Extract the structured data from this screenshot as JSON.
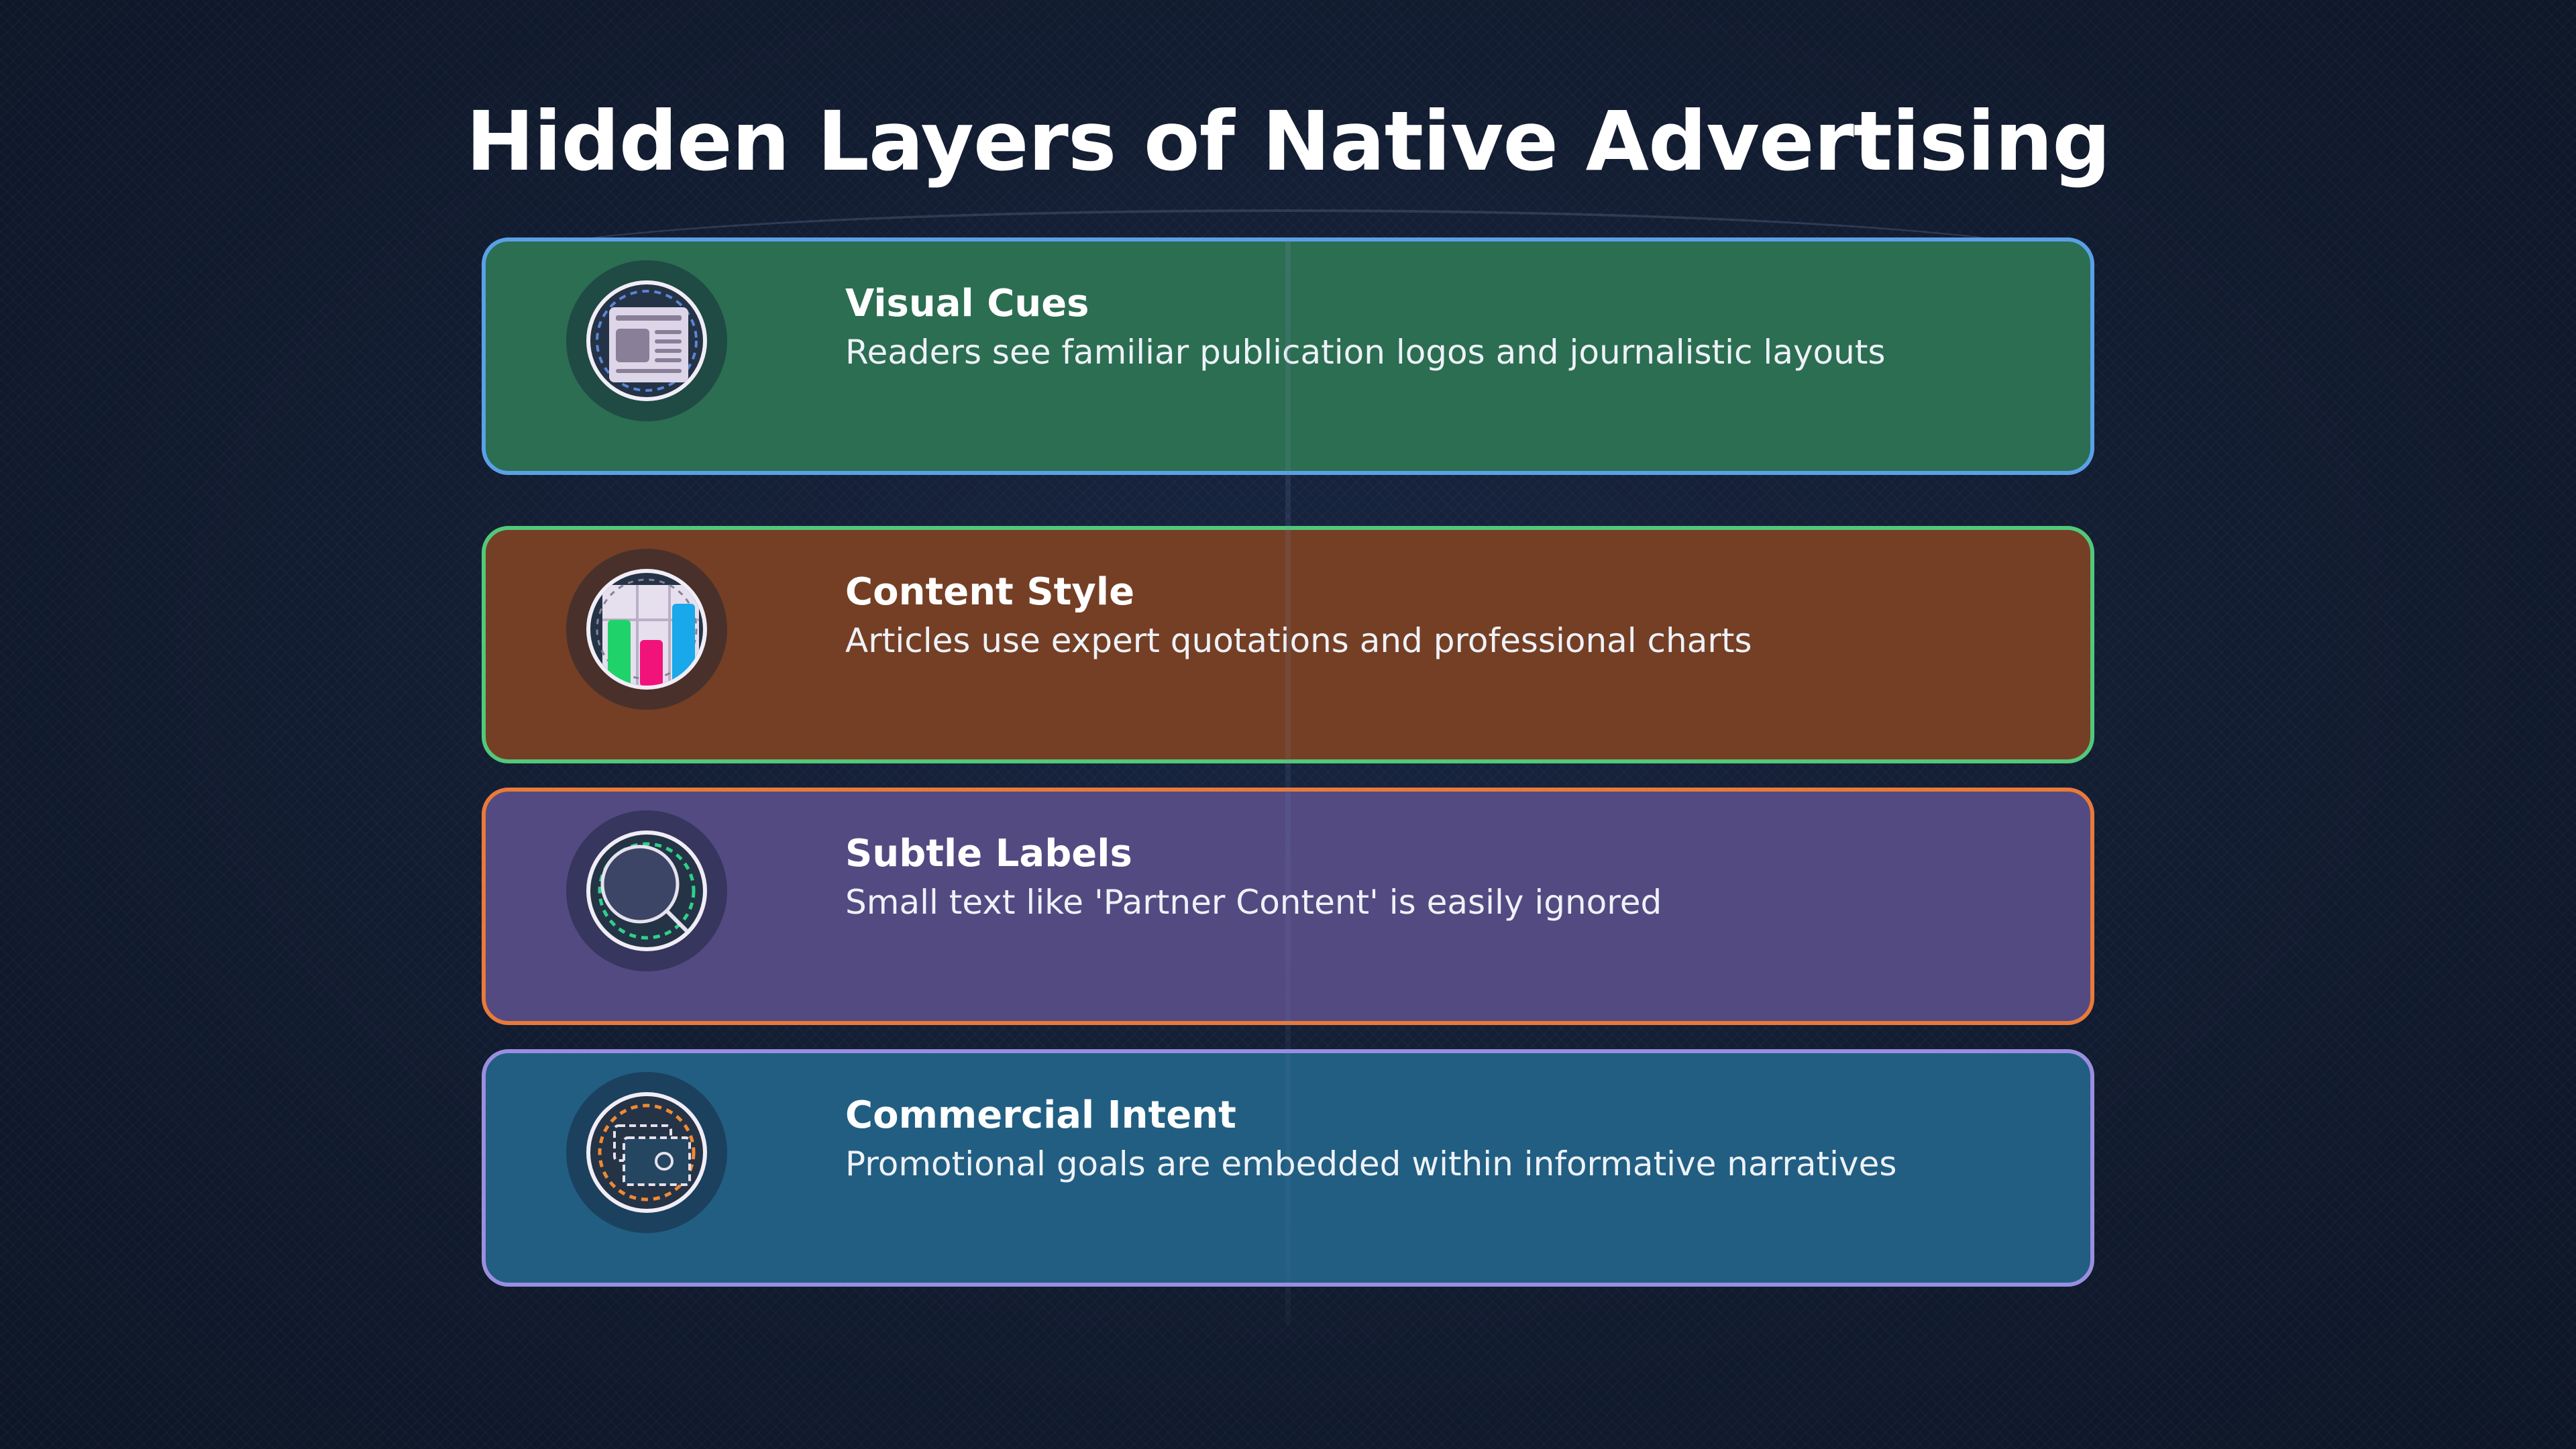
{
  "title": "Hidden Layers of Native Advertising",
  "layers": [
    {
      "title": "Visual Cues",
      "description": "Readers see familiar publication logos and journalistic layouts",
      "icon": "newspaper-icon",
      "fill": "#2b6e52",
      "border": "#5aa0e6"
    },
    {
      "title": "Content Style",
      "description": "Articles use expert quotations and professional charts",
      "icon": "bar-chart-icon",
      "fill": "#753f25",
      "border": "#52c87a"
    },
    {
      "title": "Subtle Labels",
      "description": "Small text like 'Partner Content' is easily ignored",
      "icon": "magnifier-icon",
      "fill": "#534a82",
      "border": "#e87a3a"
    },
    {
      "title": "Commercial Intent",
      "description": "Promotional goals are embedded within informative narratives",
      "icon": "wallet-icon",
      "fill": "#215e82",
      "border": "#9a8ee0"
    }
  ]
}
